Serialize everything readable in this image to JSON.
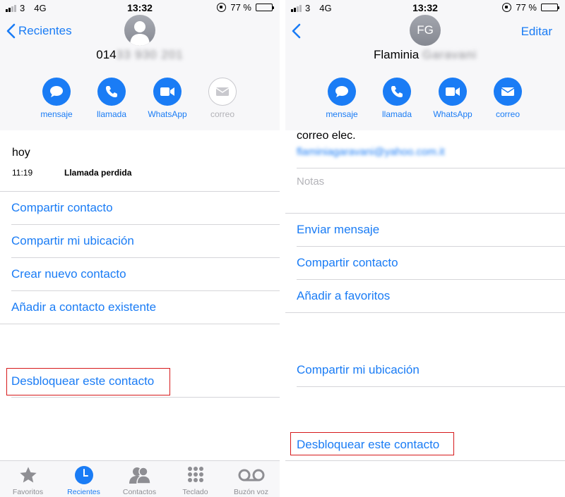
{
  "colors": {
    "accent": "#1a7cf5",
    "highlight_border": "#d6191b",
    "header_bg": "#f7f7f9"
  },
  "left": {
    "status": {
      "carrier": "3",
      "network": "4G",
      "time": "13:32",
      "battery": "77 %",
      "battery_level": 0.77
    },
    "nav": {
      "back_label": "Recientes"
    },
    "contact": {
      "number_visible": "014",
      "number_hidden": "33 930 201"
    },
    "actions": [
      {
        "label": "mensaje",
        "icon": "message-icon",
        "enabled": true
      },
      {
        "label": "llamada",
        "icon": "phone-icon",
        "enabled": true
      },
      {
        "label": "WhatsApp",
        "icon": "video-icon",
        "enabled": true
      },
      {
        "label": "correo",
        "icon": "mail-icon",
        "enabled": false
      }
    ],
    "recent": {
      "day": "hoy",
      "time": "11:19",
      "type": "Llamada perdida"
    },
    "menu": [
      "Compartir contacto",
      "Compartir mi ubicación",
      "Crear nuevo contacto",
      "Añadir a contacto existente"
    ],
    "unblock_label": "Desbloquear este contacto",
    "tabbar": [
      {
        "label": "Favoritos",
        "icon": "star-icon",
        "active": false
      },
      {
        "label": "Recientes",
        "icon": "clock-icon",
        "active": true
      },
      {
        "label": "Contactos",
        "icon": "contacts-icon",
        "active": false
      },
      {
        "label": "Teclado",
        "icon": "keypad-icon",
        "active": false
      },
      {
        "label": "Buzón voz",
        "icon": "voicemail-icon",
        "active": false
      }
    ]
  },
  "right": {
    "status": {
      "carrier": "3",
      "network": "4G",
      "time": "13:32",
      "battery": "77 %",
      "battery_level": 0.77
    },
    "nav": {
      "edit_label": "Editar"
    },
    "contact": {
      "initials": "FG",
      "first_name": "Flaminia",
      "last_name_hidden": "Garavani"
    },
    "actions": [
      {
        "label": "mensaje",
        "icon": "message-icon",
        "enabled": true
      },
      {
        "label": "llamada",
        "icon": "phone-icon",
        "enabled": true
      },
      {
        "label": "WhatsApp",
        "icon": "video-icon",
        "enabled": true
      },
      {
        "label": "correo",
        "icon": "mail-icon",
        "enabled": true
      }
    ],
    "email_label": "correo elec.",
    "email_value_hidden": "flaminiagaravani@yahoo.com.it",
    "notes_placeholder": "Notas",
    "menu": [
      "Enviar mensaje",
      "Compartir contacto",
      "Añadir a favoritos"
    ],
    "share_location": "Compartir mi ubicación",
    "unblock_label": "Desbloquear este contacto"
  }
}
